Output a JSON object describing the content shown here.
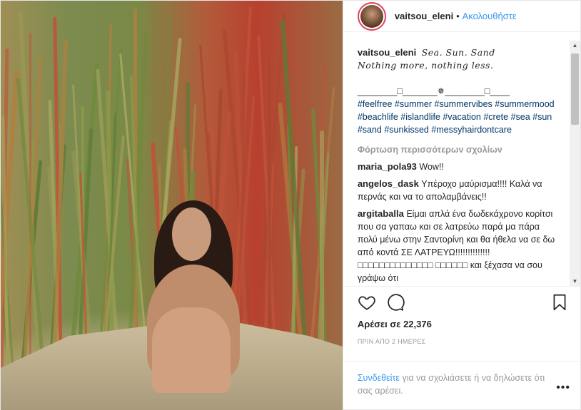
{
  "header": {
    "username": "vaitsou_eleni",
    "follow_label": "Ακολουθήστε",
    "separator": "•"
  },
  "caption": {
    "username": "vaitsou_eleni",
    "line1": "Sea. Sun. Sand",
    "line2": "Nothing more, nothing less.",
    "divider": "________□_______✵________□____",
    "hashtags": "#feelfree #summer #summervibes #summermood #beachlife #islandlife #vacation #crete #sea #sun #sand #sunkissed #messyhairdontcare"
  },
  "load_more_label": "Φόρτωση περισσότερων σχολίων",
  "comments": [
    {
      "username": "maria_pola93",
      "text": "Wow!!"
    },
    {
      "username": "angelos_dask",
      "text": "Υπέροχο μαύρισμα!!!! Καλά να περνάς και να το απολαμβάνεις!!"
    },
    {
      "username": "argitaballa",
      "text": "Είμαι απλά ένα δωδεκάχρονο κορίτσι που σα γαπαω και σε λατρεύω παρά μα πάρα πολύ μένω στην Σαντορίνη και θα ήθελα να σε δω από κοντά ΣΕ ΛΑΤΡΕΥΩ!!!!!!!!!!!!!! □□□□□□□□□□□□□□ □□□□□□ και ξέχασα να σου γράψω ότι"
    }
  ],
  "likes_text": "Αρέσει σε 22,376",
  "timestamp": "ΠΡΙΝ ΑΠΟ 2 ΗΜΕΡΕΣ",
  "login": {
    "link_label": "Συνδεθείτε",
    "rest_text": " για να σχολιάσετε ή να δηλώσετε ότι σας αρέσει.",
    "more_label": "•••"
  },
  "icons": {
    "like": "heart-icon",
    "comment": "comment-icon",
    "save": "bookmark-icon",
    "more": "more-options-icon"
  },
  "colors": {
    "link": "#3897f0",
    "hashtag": "#003569",
    "muted": "#999999",
    "text": "#262626"
  }
}
